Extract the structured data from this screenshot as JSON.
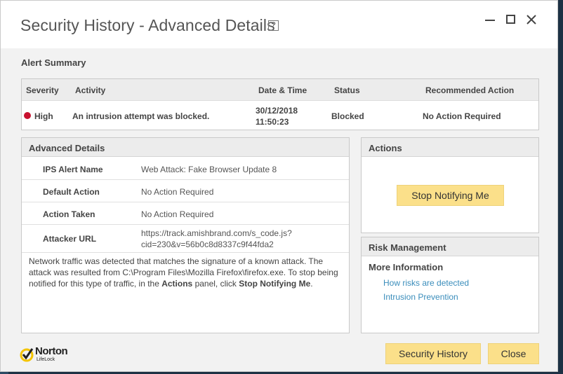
{
  "window": {
    "title": "Security History - Advanced Details",
    "help_glyph": "?"
  },
  "alert_summary": {
    "heading": "Alert Summary",
    "columns": [
      "Severity",
      "Activity",
      "Date & Time",
      "Status",
      "Recommended Action"
    ],
    "row": {
      "severity": "High",
      "severity_color": "#c8102e",
      "activity": "An intrusion attempt was blocked.",
      "date": "30/12/2018",
      "time": "11:50:23",
      "status": "Blocked",
      "recommended_action": "No Action Required"
    }
  },
  "advanced_details": {
    "heading": "Advanced Details",
    "rows": [
      {
        "label": "IPS Alert Name",
        "value": "Web Attack: Fake Browser Update 8"
      },
      {
        "label": "Default Action",
        "value": "No Action Required"
      },
      {
        "label": "Action Taken",
        "value": "No Action Required"
      },
      {
        "label": "Attacker URL",
        "value_line1": "https://track.amishbrand.com/s_code.js?",
        "value_line2": "cid=230&v=56b0c8d8337c9f44fda2"
      }
    ],
    "description": {
      "part1": "Network traffic was detected that matches the signature of a known attack. The attack was resulted from C:\\Program Files\\Mozilla Firefox\\firefox.exe. To stop being notified for this type of traffic, in the ",
      "bold1": "Actions",
      "part2": " panel, click ",
      "bold2": "Stop Notifying Me",
      "part3": "."
    }
  },
  "actions": {
    "heading": "Actions",
    "stop_button": "Stop Notifying Me"
  },
  "risk_management": {
    "heading": "Risk Management",
    "subheading": "More Information",
    "links": [
      "How risks are detected",
      "Intrusion Prevention"
    ]
  },
  "footer": {
    "logo_name": "Norton",
    "logo_sub": "LifeLock",
    "security_history_button": "Security History",
    "close_button": "Close"
  },
  "colors": {
    "button_yellow": "#fbe08a",
    "link_blue": "#3a8dbb",
    "logo_check": "#f4c400"
  }
}
